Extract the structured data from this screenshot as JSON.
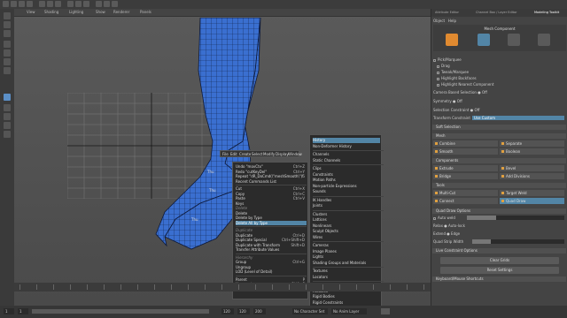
{
  "viewport_menu": [
    "View",
    "Shading",
    "Lighting",
    "Show",
    "Renderer",
    "Panels"
  ],
  "sub_menu_bar": [
    "File",
    "Edit",
    "Create",
    "Select",
    "Modify",
    "Display",
    "Window"
  ],
  "vertex_labels": [
    "Thu",
    "Thu",
    "Thu",
    "Verts",
    "Faces",
    "Tris",
    "UVs"
  ],
  "context_menu": {
    "items": [
      {
        "label": "Undo \"movCtx\"",
        "shortcut": "Ctrl+Z"
      },
      {
        "label": "Redo \"cutKeyDel\"",
        "shortcut": "Ctrl+Y"
      },
      {
        "label": "Repeat \"dR_DoCmd(\\\"meshSmooth\\\")\"",
        "shortcut": "G"
      },
      {
        "label": "Recent Commands List",
        "shortcut": ""
      },
      {
        "label": "Cut",
        "shortcut": "Ctrl+X"
      },
      {
        "label": "Copy",
        "shortcut": "Ctrl+C"
      },
      {
        "label": "Paste",
        "shortcut": "Ctrl+V"
      },
      {
        "label": "Keys",
        "shortcut": ""
      },
      {
        "label": "Delete",
        "shortcut": ""
      },
      {
        "label": "Delete by Type",
        "shortcut": ""
      },
      {
        "label": "Delete All by Type",
        "shortcut": ""
      },
      {
        "label": "Duplicate",
        "shortcut": "Ctrl+D"
      },
      {
        "label": "Duplicate Special",
        "shortcut": "Ctrl+Shift+D"
      },
      {
        "label": "Duplicate with Transform",
        "shortcut": "Shift+D"
      },
      {
        "label": "Transfer Attribute Values",
        "shortcut": ""
      },
      {
        "label": "Group",
        "shortcut": "Ctrl+G"
      },
      {
        "label": "Ungroup",
        "shortcut": ""
      },
      {
        "label": "LOD (Level of Detail)",
        "shortcut": ""
      },
      {
        "label": "Parent",
        "shortcut": "P"
      },
      {
        "label": "Unparent",
        "shortcut": "Shift+P"
      }
    ],
    "headers": [
      "Delete",
      "Duplicate",
      "Hierarchy"
    ]
  },
  "sub_menu": {
    "items": [
      "History",
      "Non-Deformer History",
      "Channels",
      "Static Channels",
      "Clips",
      "Constraints",
      "Motion Paths",
      "Non-particle Expressions",
      "Sounds",
      "IK Handles",
      "Joints",
      "Clusters",
      "Lattices",
      "Nonlinears",
      "Sculpt Objects",
      "Wires",
      "Cameras",
      "Image Planes",
      "Lights",
      "Shading Groups and Materials",
      "Textures",
      "Locators",
      "Fluids",
      "Particles",
      "Rigid Bodies",
      "Rigid Constraints",
      "Strokes",
      "Dynamic Constraints"
    ],
    "highlighted": "History"
  },
  "panel": {
    "tabs": [
      "Attribute Editor",
      "Channel Box / Layer Editor",
      "Modeling Toolkit"
    ],
    "active_tab": "Modeling Toolkit",
    "menu": [
      "Object",
      "Help"
    ],
    "mode_label": "Mesh Component",
    "pick_marquee": "Pick/Marquee",
    "drag": "Drag",
    "tweak_marquee": "Tweak/Marquee",
    "highlight_backfaces": "Highlight Backfaces",
    "highlight_nearest": "Highlight Nearest Component",
    "camera_based": "Camera Based Selection",
    "off": "Off",
    "symmetry": "Symmetry",
    "symmetry_val": "Off",
    "selection_constraint": "Selection Constraint",
    "selection_constraint_val": "Off",
    "transform_constraint": "Transform Constraint",
    "transform_constraint_val": "Use Custom",
    "soft_selection": "Soft Selection",
    "mesh_section": "Mesh",
    "mesh_buttons": [
      "Combine",
      "Separate",
      "Smooth",
      "Boolean"
    ],
    "components_section": "Components",
    "component_buttons": [
      "Extrude",
      "Bevel",
      "Bridge",
      "Add Divisions"
    ],
    "tools_section": "Tools",
    "tool_buttons": [
      "Multi-Cut",
      "Target Weld",
      "Connect",
      "Quad Draw"
    ],
    "quad_draw_options": "Quad Draw Options",
    "auto_weld": "Auto weld",
    "relax": "Relax",
    "auto_lock": "Auto-lock",
    "extend": "Extend",
    "edge": "Edge",
    "quad_strip_width": "Quad Strip Width",
    "live_constraint": "Live Constraint Options",
    "clear_grids": "Clear Grids",
    "reset_settings": "Reset Settings",
    "keyboard_mouse": "Keyboard/Mouse Shortcuts"
  },
  "range": {
    "start": "1",
    "inner_start": "1",
    "inner_end": "120",
    "end": "120",
    "end2": "200",
    "character_set": "No Character Set",
    "anim_layer": "No Anim Layer"
  },
  "colors": {
    "highlight": "#5285a6",
    "mesh": "#3a6fd0",
    "accent_orange": "#e0a040"
  }
}
